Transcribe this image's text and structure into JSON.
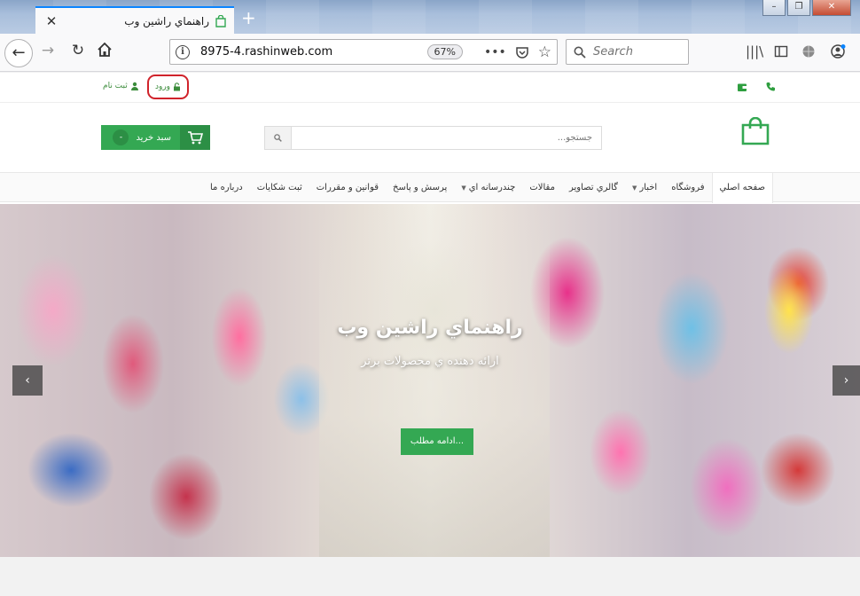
{
  "browser": {
    "tab_title": "راهنماي راشين وب",
    "tab_close": "✕",
    "new_tab": "+",
    "url": "8975-4.rashinweb.com",
    "zoom": "67%",
    "url_more": "•••",
    "search_placeholder": "Search"
  },
  "topstrip": {
    "login_label": "ورود",
    "register_label": "ثبت نام"
  },
  "header": {
    "cart_label": "سبد خريد",
    "cart_count": "-",
    "search_placeholder": "جستجو..."
  },
  "menu": {
    "items": [
      "صفحه اصلي",
      "فروشگاه",
      "اخبار",
      "گالري تصاوير",
      "مقالات",
      "چندرسانه اي",
      "پرسش و پاسخ",
      "قوانين و مقررات",
      "ثبت شكايات",
      "درباره ما"
    ]
  },
  "slider": {
    "title": "راهنماي راشين وب",
    "subtitle": "ارائه دهنده ي محصولات برتر",
    "button_label": "ادامه مطلب...",
    "prev": "‹",
    "next": "›"
  },
  "colors": {
    "brand_green": "#34a853",
    "highlight_red": "#d0232b",
    "firefox_blue": "#0a84ff"
  }
}
